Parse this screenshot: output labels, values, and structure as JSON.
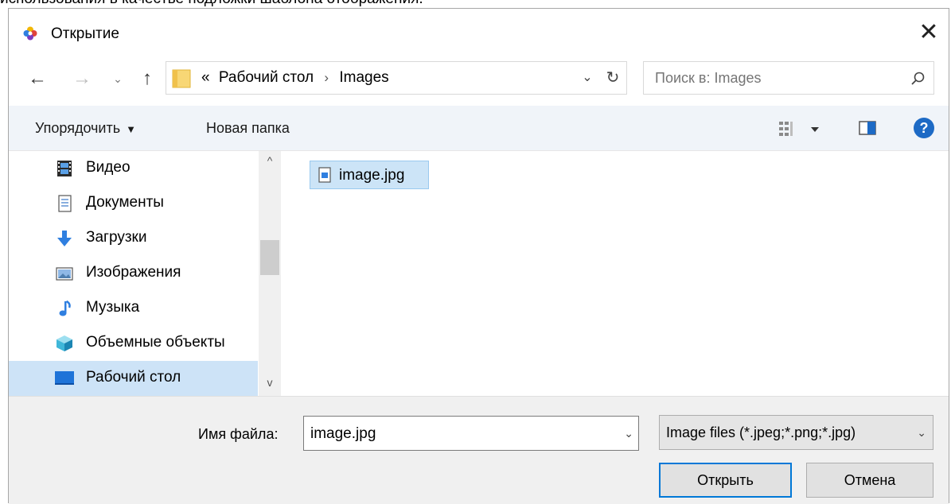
{
  "caption": "использования в качестве подложки шаблона отображения.",
  "window": {
    "title": "Открытие",
    "close_symbol": "✕"
  },
  "nav": {
    "back_symbol": "←",
    "forward_symbol": "→",
    "recent_symbol": "⌄",
    "up_symbol": "↑"
  },
  "address": {
    "overflow": "«",
    "crumbs": [
      "Рабочий стол",
      "Images"
    ],
    "separator": "›",
    "dropdown_symbol": "⌄",
    "refresh_symbol": "↻"
  },
  "search": {
    "placeholder": "Поиск в: Images"
  },
  "toolbar": {
    "organize_label": "Упорядочить",
    "organize_caret": "▼",
    "new_folder_label": "Новая папка",
    "help_symbol": "?"
  },
  "sidebar": {
    "items": [
      {
        "label": "Видео",
        "icon": "video-icon"
      },
      {
        "label": "Документы",
        "icon": "documents-icon"
      },
      {
        "label": "Загрузки",
        "icon": "downloads-icon"
      },
      {
        "label": "Изображения",
        "icon": "pictures-icon"
      },
      {
        "label": "Музыка",
        "icon": "music-icon"
      },
      {
        "label": "Объемные объекты",
        "icon": "3d-objects-icon"
      },
      {
        "label": "Рабочий стол",
        "icon": "desktop-icon",
        "selected": true
      }
    ],
    "scroll_up_symbol": "^",
    "scroll_down_symbol": "v"
  },
  "files": [
    {
      "name": "image.jpg",
      "icon": "image-file-icon",
      "selected": true
    }
  ],
  "filename": {
    "label": "Имя файла:",
    "value": "image.jpg",
    "dropdown_symbol": "⌄"
  },
  "filetype": {
    "selected": "Image files (*.jpeg;*.png;*.jpg)",
    "dropdown_symbol": "⌄"
  },
  "buttons": {
    "open": "Открыть",
    "cancel": "Отмена"
  },
  "colors": {
    "accent": "#0078d7",
    "selection": "#cde3f7",
    "toolbar_bg": "#f0f4f9",
    "footer_bg": "#f0f0f0"
  }
}
